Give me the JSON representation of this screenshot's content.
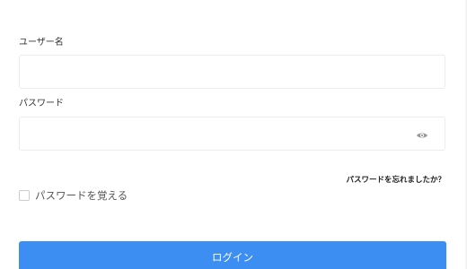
{
  "form": {
    "username": {
      "label": "ユーザー名",
      "value": "",
      "placeholder": ""
    },
    "password": {
      "label": "パスワード",
      "value": "",
      "placeholder": "",
      "toggle_icon": "eye-icon"
    },
    "forgot_link": "パスワードを忘れましたか？",
    "remember_me": {
      "label": "パスワードを覚える",
      "checked": false
    },
    "submit_label": "ログイン"
  },
  "colors": {
    "accent": "#3d8ef3",
    "input_border": "#eaecef",
    "icon": "#9a9a9a"
  }
}
